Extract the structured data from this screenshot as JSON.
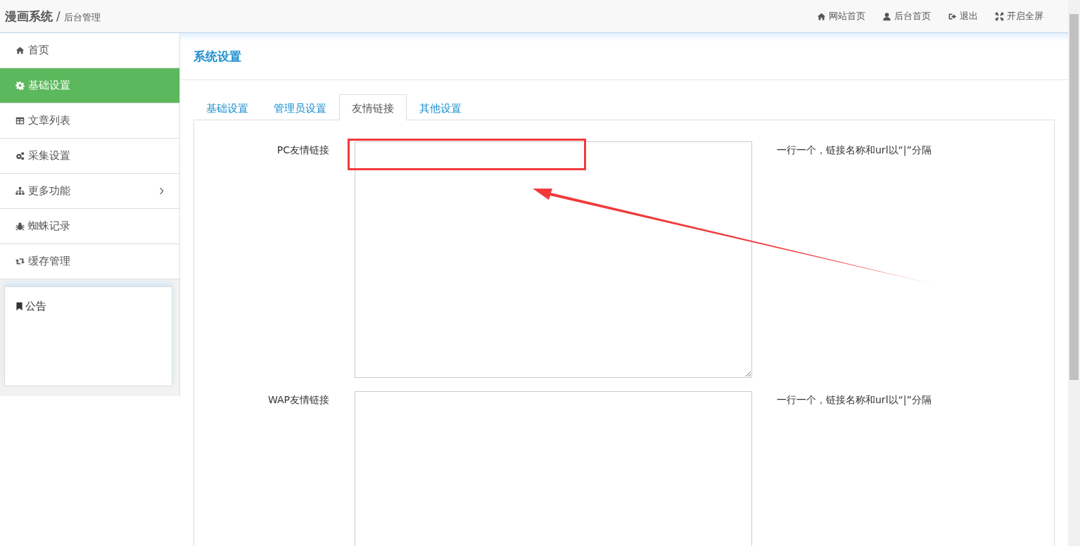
{
  "header": {
    "brand": "漫画系统",
    "separator": "/",
    "subtitle": "后台管理",
    "links": [
      {
        "kind": "home",
        "label": "网站首页"
      },
      {
        "kind": "user",
        "label": "后台首页"
      },
      {
        "kind": "signout",
        "label": "退出"
      },
      {
        "kind": "expand",
        "label": "开启全屏"
      }
    ]
  },
  "sidebar": {
    "items": [
      {
        "kind": "home",
        "label": "首页",
        "selected": false,
        "has_children": false
      },
      {
        "kind": "gear",
        "label": "基础设置",
        "selected": true,
        "has_children": false
      },
      {
        "kind": "table",
        "label": "文章列表",
        "selected": false,
        "has_children": false
      },
      {
        "kind": "gears",
        "label": "采集设置",
        "selected": false,
        "has_children": false
      },
      {
        "kind": "sitemap",
        "label": "更多功能",
        "selected": false,
        "has_children": true
      },
      {
        "kind": "bug",
        "label": "蜘蛛记录",
        "selected": false,
        "has_children": false
      },
      {
        "kind": "retweet",
        "label": "缓存管理",
        "selected": false,
        "has_children": false
      }
    ],
    "notice": {
      "title": "公告"
    }
  },
  "main": {
    "title": "系统设置",
    "tabs": [
      {
        "label": "基础设置",
        "selected": false
      },
      {
        "label": "管理员设置",
        "selected": false
      },
      {
        "label": "友情链接",
        "selected": true
      },
      {
        "label": "其他设置",
        "selected": false
      }
    ],
    "fields": [
      {
        "label": "PC友情链接",
        "hint": "一行一个，链接名称和url以“|”分隔"
      },
      {
        "label": "WAP友情链接",
        "hint": "一行一个，链接名称和url以“|”分隔"
      }
    ]
  },
  "annotations": {
    "highlight_box": true,
    "arrow": true
  }
}
